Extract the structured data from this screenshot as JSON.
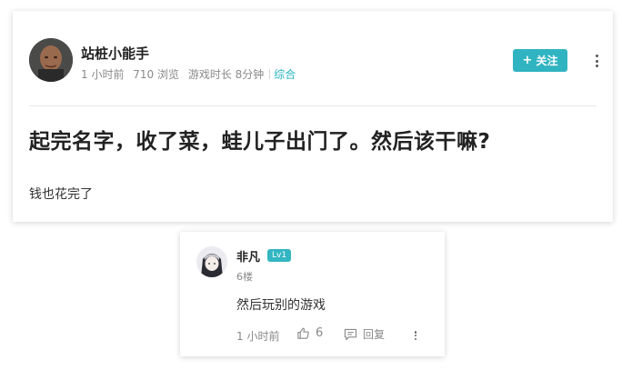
{
  "post": {
    "author": "站桩小能手",
    "meta": {
      "time": "1 小时前",
      "views": "710 浏览",
      "playtime": "游戏时长 8分钟",
      "category": "综合"
    },
    "follow_label": "关注",
    "title": "起完名字，收了菜，蛙儿子出门了。然后该干嘛?",
    "body": "钱也花完了"
  },
  "reply": {
    "author": "非凡",
    "level": "Lv1",
    "floor": "6楼",
    "text": "然后玩别的游戏",
    "time": "1 小时前",
    "likes": "6",
    "reply_label": "回复"
  },
  "colors": {
    "accent": "#31b4c1",
    "category": "#2bb3c0"
  }
}
